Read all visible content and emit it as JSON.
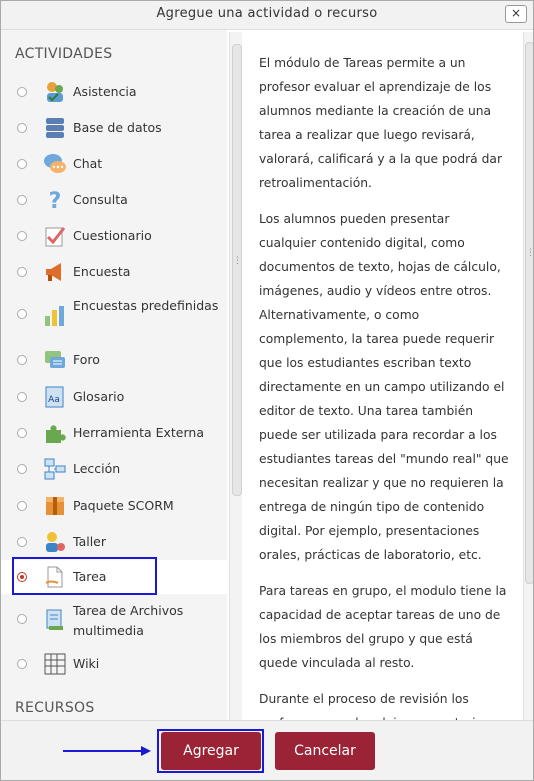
{
  "dialog": {
    "title": "Agregue una actividad o recurso",
    "close_label": "×"
  },
  "activities": {
    "header": "ACTIVIDADES",
    "items": [
      {
        "label": "Asistencia",
        "icon": "attendance-icon"
      },
      {
        "label": "Base de datos",
        "icon": "database-icon"
      },
      {
        "label": "Chat",
        "icon": "chat-icon"
      },
      {
        "label": "Consulta",
        "icon": "question-icon"
      },
      {
        "label": "Cuestionario",
        "icon": "quiz-icon"
      },
      {
        "label": "Encuesta",
        "icon": "megaphone-icon"
      },
      {
        "label": "Encuestas predefinidas",
        "icon": "bar-chart-icon"
      },
      {
        "label": "Foro",
        "icon": "forum-icon"
      },
      {
        "label": "Glosario",
        "icon": "glossary-icon"
      },
      {
        "label": "Herramienta Externa",
        "icon": "puzzle-icon"
      },
      {
        "label": "Lección",
        "icon": "lesson-icon"
      },
      {
        "label": "Paquete SCORM",
        "icon": "package-icon"
      },
      {
        "label": "Taller",
        "icon": "workshop-icon"
      },
      {
        "label": "Tarea",
        "icon": "assignment-icon",
        "selected": true
      },
      {
        "label": "Tarea de Archivos multimedia",
        "icon": "multimedia-assignment-icon"
      },
      {
        "label": "Wiki",
        "icon": "wiki-icon"
      }
    ]
  },
  "resources": {
    "header": "RECURSOS"
  },
  "description": {
    "paragraphs": [
      "El módulo de Tareas permite a un profesor evaluar el aprendizaje de los alumnos mediante la creación de una tarea a realizar que luego revisará, valorará, calificará y a la que podrá dar retroalimentación.",
      "Los alumnos pueden presentar cualquier contenido digital, como documentos de texto, hojas de cálculo, imágenes, audio y vídeos entre otros. Alternativamente, o como complemento, la tarea puede requerir que los estudiantes escriban texto directamente en un campo utilizando el editor de texto. Una tarea también puede ser utilizada para recordar a los estudiantes tareas del \"mundo real\" que necesitan realizar y que no requieren la entrega de ningún tipo de contenido digital. Por ejemplo, presentaciones orales, prácticas de laboratorio, etc.",
      "Para tareas en grupo, el modulo tiene la capacidad de aceptar tareas de uno de los miembros del grupo y que está quede vinculada al resto.",
      "Durante el proceso de revisión los profesores pueden dejar comentarios y subir archivos, tales como trabajos"
    ]
  },
  "footer": {
    "add_label": "Agregar",
    "cancel_label": "Cancelar"
  },
  "colors": {
    "button_bg": "#9b2336",
    "highlight_border": "#1a1ad6",
    "radio_checked": "#c0392b"
  }
}
